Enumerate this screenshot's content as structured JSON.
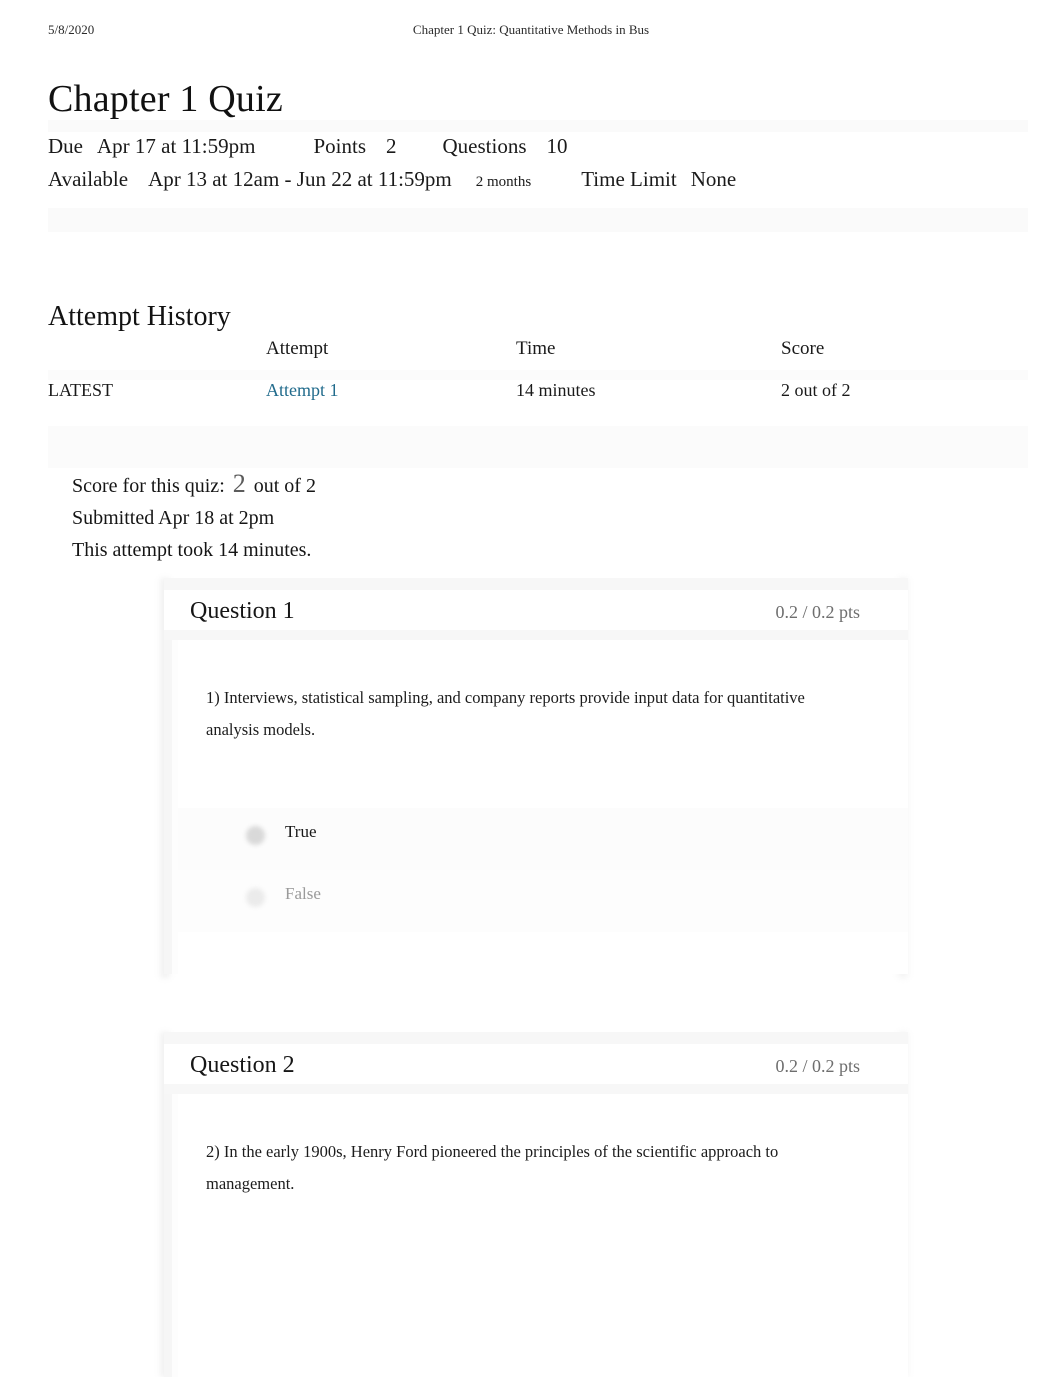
{
  "print_header": {
    "date": "5/8/2020",
    "title": "Chapter 1 Quiz: Quantitative Methods in Bus"
  },
  "page_title": "Chapter 1 Quiz",
  "quiz_meta": {
    "due_label": "Due",
    "due_value": "Apr 17 at 11:59pm",
    "points_label": "Points",
    "points_value": "2",
    "questions_label": "Questions",
    "questions_value": "10",
    "available_label": "Available",
    "available_value": "Apr 13 at 12am - Jun 22 at 11:59pm",
    "duration_note": "2 months",
    "time_limit_label": "Time Limit",
    "time_limit_value": "None"
  },
  "attempt_history": {
    "heading": "Attempt History",
    "columns": [
      "",
      "Attempt",
      "Time",
      "Score"
    ],
    "rows": [
      {
        "marker": "LATEST",
        "attempt": "Attempt 1",
        "time": "14 minutes",
        "score": "2 out of 2"
      }
    ]
  },
  "score_summary": {
    "score_label": "Score for this quiz:",
    "score_value": "2",
    "score_out_of": "out of 2",
    "submitted": "Submitted Apr 18 at 2pm",
    "duration": "This attempt took 14 minutes."
  },
  "questions": [
    {
      "title": "Question 1",
      "points": "0.2 / 0.2 pts",
      "text": "1) Interviews, statistical sampling, and company reports provide input data for quantitative analysis models.",
      "answers": [
        {
          "label": "True",
          "selected": true
        },
        {
          "label": "False",
          "selected": false
        }
      ]
    },
    {
      "title": "Question 2",
      "points": "0.2 / 0.2 pts",
      "text": "2) In the early 1900s, Henry Ford pioneered the principles of the scientific approach to management.",
      "answers": []
    }
  ],
  "colors": {
    "link": "#216b8c",
    "points_text": "#6e6e6e",
    "muted_answer": "#9a9a9a",
    "band": "#fafafa"
  }
}
